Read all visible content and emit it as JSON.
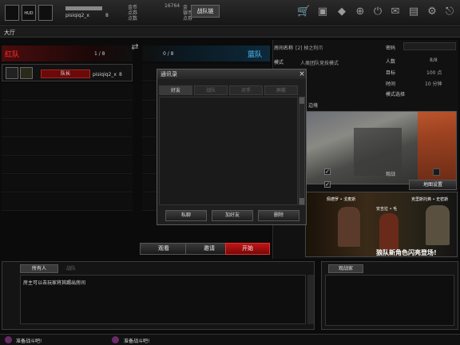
{
  "top": {
    "hud_label": "HUD",
    "player_name": "pisiqiq2_x",
    "player_rank": "8",
    "currency_1_label": "金币",
    "currency_2_label": "点券",
    "currency_3_label": "点数",
    "stat_value": "16764",
    "stat_label_1": "金",
    "stat_label_2": "银币",
    "stat_label_3": "点券",
    "clan_label": "战队链"
  },
  "lobby": {
    "title": "大厅"
  },
  "red_team": {
    "name": "红队",
    "count": "1 / 8",
    "leader_label": "队长",
    "player_name": "pisiqiq2_x",
    "player_rank": "8"
  },
  "blue_team": {
    "name": "蓝队",
    "count": "0 / 8"
  },
  "room": {
    "name_label": "房间名称",
    "name_value": "[2] 掉之利爪",
    "password_label": "密码",
    "mode_label": "模式",
    "mode_value": "人类团队竞技模式",
    "players_label": "人数",
    "players_value": "8/8",
    "target_label": "目标",
    "target_value": "100 点",
    "time_label": "时间",
    "time_value": "10 分钟",
    "mode_select_label": "模式选择",
    "map_name": "边境",
    "observe_label": "观战",
    "map_settings_label": "地图设置"
  },
  "dialog": {
    "title": "通讯录",
    "close": "×",
    "tabs": [
      "好友",
      "战队",
      "对手",
      "屏蔽"
    ],
    "btn_whisper": "私聊",
    "btn_add_friend": "加好友",
    "btn_delete": "删除"
  },
  "banner": {
    "name_1": "佩德罗 • 戈麦斯",
    "name_2": "安吉拉 • 毛",
    "name_3": "克里斯托弗 • 史密斯",
    "slogan": "狼队新角色闪亮登场!"
  },
  "actions": {
    "watch": "观看",
    "invite": "邀请",
    "start": "开始"
  },
  "chat": {
    "tabs": [
      "所有人",
      "战队"
    ],
    "message": "房主可以击玩家将其踢出房间"
  },
  "spectators": {
    "title": "观战家"
  },
  "status": {
    "ready_1": "准备战斗吧!",
    "ready_2": "准备战斗吧!"
  },
  "colors": {
    "accent_red": "#8a1010",
    "accent_blue": "#1a4c66",
    "start_red": "#a30f0f"
  }
}
